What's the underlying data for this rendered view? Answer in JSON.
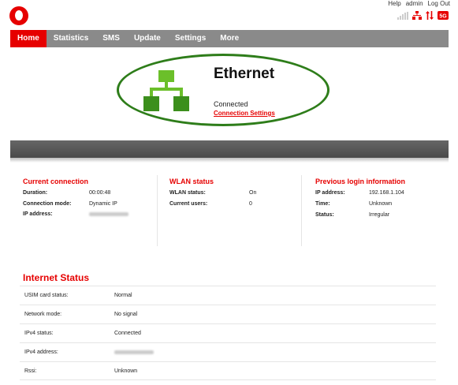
{
  "top_links": {
    "help": "Help",
    "user": "admin",
    "logout": "Log Out"
  },
  "status_icons": [
    "signal-bars-icon",
    "network-icon",
    "data-transfer-icon",
    "5g-icon"
  ],
  "status_badge": "5G",
  "nav": [
    "Home",
    "Statistics",
    "SMS",
    "Update",
    "Settings",
    "More"
  ],
  "ethernet": {
    "title": "Ethernet",
    "status": "Connected",
    "link": "Connection Settings"
  },
  "current_connection": {
    "title": "Current connection",
    "rows": [
      {
        "label": "Duration:",
        "value": "00:00:48"
      },
      {
        "label": "Connection mode:",
        "value": "Dynamic IP"
      },
      {
        "label": "IP address:",
        "value": ""
      }
    ]
  },
  "wlan_status": {
    "title": "WLAN status",
    "rows": [
      {
        "label": "WLAN status:",
        "value": "On"
      },
      {
        "label": "Current users:",
        "value": "0"
      }
    ]
  },
  "previous_login": {
    "title": "Previous login information",
    "rows": [
      {
        "label": "IP address:",
        "value": "192.168.1.104"
      },
      {
        "label": "Time:",
        "value": "Unknown"
      },
      {
        "label": "Status:",
        "value": "Irregular"
      }
    ]
  },
  "internet_status": {
    "title": "Internet Status",
    "rows": [
      {
        "label": "USIM card status:",
        "value": "Normal"
      },
      {
        "label": "Network mode:",
        "value": "No signal"
      },
      {
        "label": "IPv4 status:",
        "value": "Connected"
      },
      {
        "label": "IPv4 address:",
        "value": ""
      },
      {
        "label": "Rssi:",
        "value": "Unknown"
      }
    ]
  },
  "colors": {
    "brand_red": "#e60000",
    "nav_gray": "#8a8a8a",
    "ethernet_green": "#6bbf2a",
    "ellipse_green": "#2e7d1a"
  }
}
